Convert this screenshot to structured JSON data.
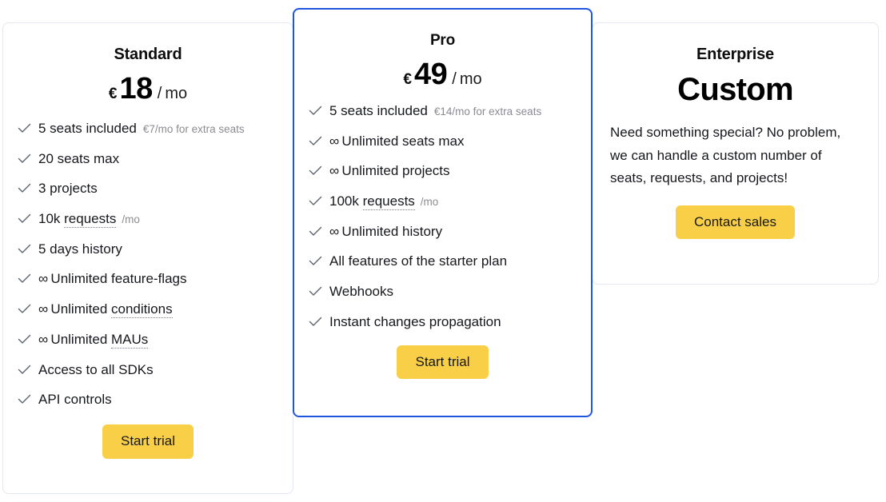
{
  "theme": {
    "accent_yellow": "#f9cf48",
    "highlight_blue": "#1f56e0",
    "card_border": "#e3e7ef",
    "muted_text": "#8b8b93",
    "check_color": "#5c6470"
  },
  "plans": {
    "standard": {
      "name": "Standard",
      "price": {
        "currency": "€",
        "amount": "18",
        "slash": "/",
        "period": "mo"
      },
      "features": [
        {
          "prefix": "",
          "text": "5 seats included",
          "sub": "€7/mo for extra seats",
          "term": ""
        },
        {
          "prefix": "",
          "text": "20 seats max",
          "sub": "",
          "term": ""
        },
        {
          "prefix": "",
          "text": "3 projects",
          "sub": "",
          "term": ""
        },
        {
          "prefix": "10k ",
          "text": "",
          "term": "requests",
          "sub": "/mo"
        },
        {
          "prefix": "",
          "text": "5 days history",
          "sub": "",
          "term": ""
        },
        {
          "prefix": "∞",
          "text": "Unlimited feature-flags",
          "sub": "",
          "term": ""
        },
        {
          "prefix": "∞",
          "text": "Unlimited ",
          "term": "conditions",
          "sub": ""
        },
        {
          "prefix": "∞",
          "text": "Unlimited ",
          "term": "MAUs",
          "sub": ""
        },
        {
          "prefix": "",
          "text": "Access to all SDKs",
          "sub": "",
          "term": ""
        },
        {
          "prefix": "",
          "text": "API controls",
          "sub": "",
          "term": ""
        }
      ],
      "cta": "Start trial"
    },
    "pro": {
      "name": "Pro",
      "price": {
        "currency": "€",
        "amount": "49",
        "slash": "/",
        "period": "mo"
      },
      "features": [
        {
          "prefix": "",
          "text": "5 seats included",
          "sub": "€14/mo for extra seats",
          "term": ""
        },
        {
          "prefix": "∞",
          "text": "Unlimited seats max",
          "sub": "",
          "term": ""
        },
        {
          "prefix": "∞",
          "text": "Unlimited projects",
          "sub": "",
          "term": ""
        },
        {
          "prefix": "100k ",
          "text": "",
          "term": "requests",
          "sub": "/mo"
        },
        {
          "prefix": "∞",
          "text": "Unlimited history",
          "sub": "",
          "term": ""
        },
        {
          "prefix": "",
          "text": "All features of the starter plan",
          "sub": "",
          "term": ""
        },
        {
          "prefix": "",
          "text": "Webhooks",
          "sub": "",
          "term": ""
        },
        {
          "prefix": "",
          "text": "Instant changes propagation",
          "sub": "",
          "term": ""
        }
      ],
      "cta": "Start trial"
    },
    "enterprise": {
      "name": "Enterprise",
      "price_custom": "Custom",
      "blurb": "Need something special? No problem, we can handle a custom number of seats, requests, and projects!",
      "cta": "Contact sales"
    }
  },
  "icons": {
    "check": "check-icon"
  }
}
